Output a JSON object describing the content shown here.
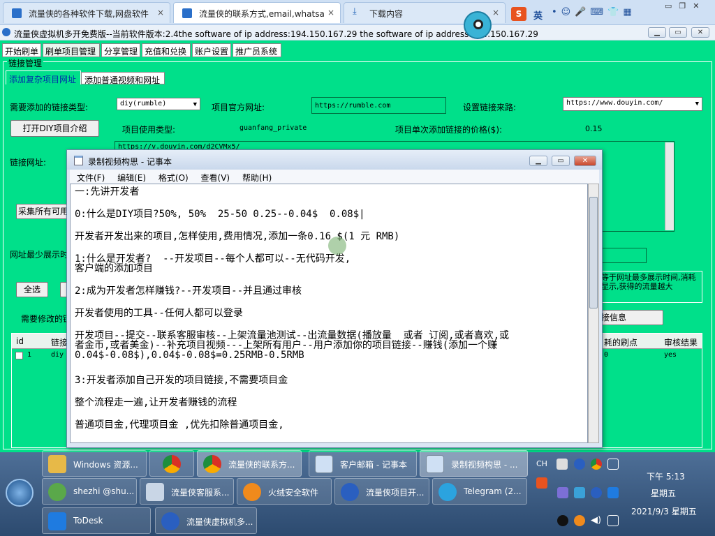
{
  "browser": {
    "tabs": [
      {
        "label": "流量侠的各种软件下载,网盘软件",
        "close": "×"
      },
      {
        "label": "流量侠的联系方式,email,whatsa",
        "close": "×"
      },
      {
        "label": "下载内容",
        "close": "×"
      }
    ],
    "ime": "英"
  },
  "app": {
    "title": "流量侠虚拟机多开免费版--当前软件版本:2.4the software of ip address:194.150.167.29  the software of ip address:194.150.167.29",
    "menu": [
      "开始刷单",
      "刷单项目管理",
      "分享管理",
      "充值和兑换",
      "账户设置",
      "推广员系统"
    ],
    "group_title": "链接管理",
    "subtabs": [
      "添加复杂项目网址",
      "添加普通视频和网址"
    ],
    "form": {
      "link_type_label": "需要添加的链接类型:",
      "link_type_value": "diy(rumble)",
      "official_url_label": "项目官方网址:",
      "official_url_value": "https://rumble.com",
      "source_label": "设置链接来路:",
      "source_value": "https://www.douyin.com/",
      "open_diy_button": "打开DIY项目介绍",
      "usage_type_label": "项目使用类型:",
      "usage_type_value": "guanfang_private",
      "price_label": "项目单次添加链接的价格($):",
      "price_value": "0.15",
      "link_url_label": "链接网址:",
      "link_url_value": "https://v.douyin.com/d2CVMx5/",
      "collect_button": "采集所有可用",
      "min_show_label": "网址最少展示时",
      "select_all_button": "全选",
      "modify_label": "需要修改的链",
      "desc_text": "等于网址最多展示时间,消耗 显示,获得的流量越大",
      "link_info_button": "接信息"
    },
    "table": {
      "headers": [
        "id",
        "链接",
        "耗的刷点",
        "审核结果"
      ],
      "rows": [
        {
          "id": "1",
          "type": "diy",
          "points": "0",
          "result": "yes"
        }
      ]
    }
  },
  "notepad": {
    "title": "录制视频构思 - 记事本",
    "menu": [
      "文件(F)",
      "编辑(E)",
      "格式(O)",
      "查看(V)",
      "帮助(H)"
    ],
    "lines": [
      "一:先讲开发者",
      "0:什么是DIY项目?50%, 50%  25-50 0.25--0.04$  0.08$|",
      "开发者开发出来的项目,怎样使用,费用情况,添加一条0.16 $(1 元 RMB)",
      "1:什么是开发者?  --开发项目--每个人都可以--无代码开发,",
      "客户端的添加项目",
      "2:成为开发者怎样赚钱?--开发项目--并且通过审核",
      "开发者使用的工具--任何人都可以登录",
      "开发项目--提交--联系客服审核--上架流量池测试--出流量数据(播放量  或者 订阅,或者喜欢,或",
      "者金币,或者美金)--补充项目视频---上架所有用户--用户添加你的项目链接--赚钱(添加一个赚",
      "0.04$-0.08$),0.04$-0.08$=0.25RMB-0.5RMB",
      "3:开发者添加自己开发的项目链接,不需要项目金",
      "整个流程走一遍,让开发者赚钱的流程",
      "普通项目金,代理项目金 ,优先扣除普通项目金,"
    ]
  },
  "taskbar": {
    "items": [
      {
        "label": "Windows 资源..."
      },
      {
        "label": ""
      },
      {
        "label": "流量侠的联系方..."
      },
      {
        "label": "客户邮箱 - 记事本"
      },
      {
        "label": "录制视频构思 - ..."
      },
      {
        "label": "shezhi @shu..."
      },
      {
        "label": "流量侠客服系..."
      },
      {
        "label": "火绒安全软件"
      },
      {
        "label": "流量侠项目开..."
      },
      {
        "label": "Telegram (2..."
      },
      {
        "label": "ToDesk"
      },
      {
        "label": "流量侠虚拟机多..."
      }
    ],
    "lang": "CH",
    "clock_time": "下午 5:13",
    "clock_day": "星期五",
    "clock_date": "2021/9/3 星期五"
  }
}
